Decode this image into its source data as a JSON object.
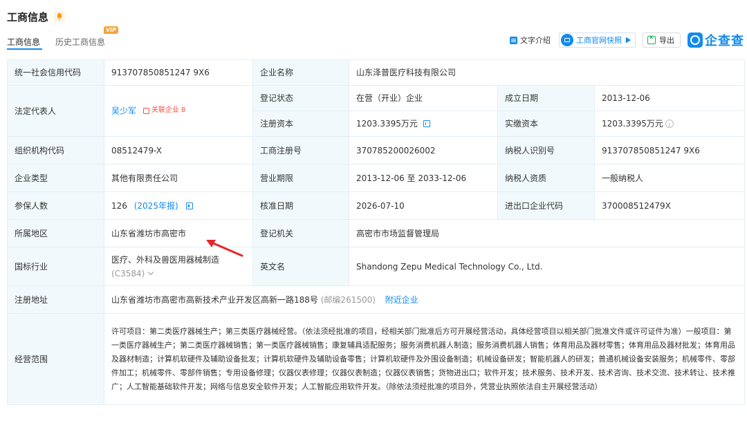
{
  "header": {
    "title": "工商信息"
  },
  "tabs": [
    {
      "label": "工商信息",
      "active": true
    },
    {
      "label": "历史工商信息",
      "badge": "VIP"
    }
  ],
  "toolbar": {
    "text_intro": "文字介绍",
    "snapshot": "工商官网快照",
    "export": "导出",
    "logo": "企查查"
  },
  "company": {
    "credit_code_label": "统一社会信用代码",
    "credit_code": "913707850851247 9X6",
    "name_label": "企业名称",
    "name": "山东泽普医疗科技有限公司",
    "legal_rep_label": "法定代表人",
    "legal_rep": "吴少军",
    "related_label": "关联企业",
    "related_count": "8",
    "status_label": "登记状态",
    "status": "在营（开业）企业",
    "est_date_label": "成立日期",
    "est_date": "2013-12-06",
    "reg_capital_label": "注册资本",
    "reg_capital": "1203.3395万元",
    "paid_capital_label": "实缴资本",
    "paid_capital": "1203.3395万元",
    "org_code_label": "组织机构代码",
    "org_code": "08512479-X",
    "reg_no_label": "工商注册号",
    "reg_no": "370785200026002",
    "taxpayer_id_label": "纳税人识别号",
    "taxpayer_id": "913707850851247 9X6",
    "type_label": "企业类型",
    "type": "其他有限责任公司",
    "term_label": "营业期限",
    "term": "2013-12-06 至 2033-12-06",
    "tax_qual_label": "纳税人资质",
    "tax_qual": "一般纳税人",
    "insured_label": "参保人数",
    "insured": "126",
    "insured_report": "(2025年报)",
    "approve_date_label": "核准日期",
    "approve_date": "2026-07-10",
    "ie_code_label": "进出口企业代码",
    "ie_code": "370008512479X",
    "region_label": "所属地区",
    "region": "山东省潍坊市高密市",
    "authority_label": "登记机关",
    "authority": "高密市市场监督管理局",
    "industry_label": "国标行业",
    "industry": "医疗、外科及兽医用器械制造",
    "industry_code": "(C3584)",
    "english_label": "英文名",
    "english": "Shandong Zepu Medical Technology Co., Ltd.",
    "address_label": "注册地址",
    "address": "山东省潍坊市高密市高新技术产业开发区高新一路188号",
    "postcode": "(邮编261500)",
    "nearby": "附近企业",
    "scope_label": "经营范围",
    "scope": "许可项目：第二类医疗器械生产；第三类医疗器械经营。（依法须经批准的项目，经相关部门批准后方可开展经营活动，具体经营项目以相关部门批准文件或许可证件为准）一般项目：第一类医疗器械生产；第二类医疗器械销售；第一类医疗器械销售；康复辅具适配服务；服务消费机器人制造；服务消费机器人销售；体育用品及器材零售；体育用品及器材批发；体育用品及器材制造；计算机软硬件及辅助设备批发；计算机软硬件及辅助设备零售；计算机软硬件及外围设备制造；机械设备研发；智能机器人的研发；普通机械设备安装服务；机械零件、零部件加工；机械零件、零部件销售；专用设备修理；仪器仪表修理；仪器仪表制造；仪器仪表销售；货物进出口；软件开发；技术服务、技术开发、技术咨询、技术交流、技术转让、技术推广；人工智能基础软件开发；网络与信息安全软件开发；人工智能应用软件开发。（除依法须经批准的项目外，凭营业执照依法自主开展经营活动）"
  },
  "colors": {
    "accent": "#128bed",
    "label_bg": "#f2f9fc",
    "annotation": "#e8262a"
  }
}
